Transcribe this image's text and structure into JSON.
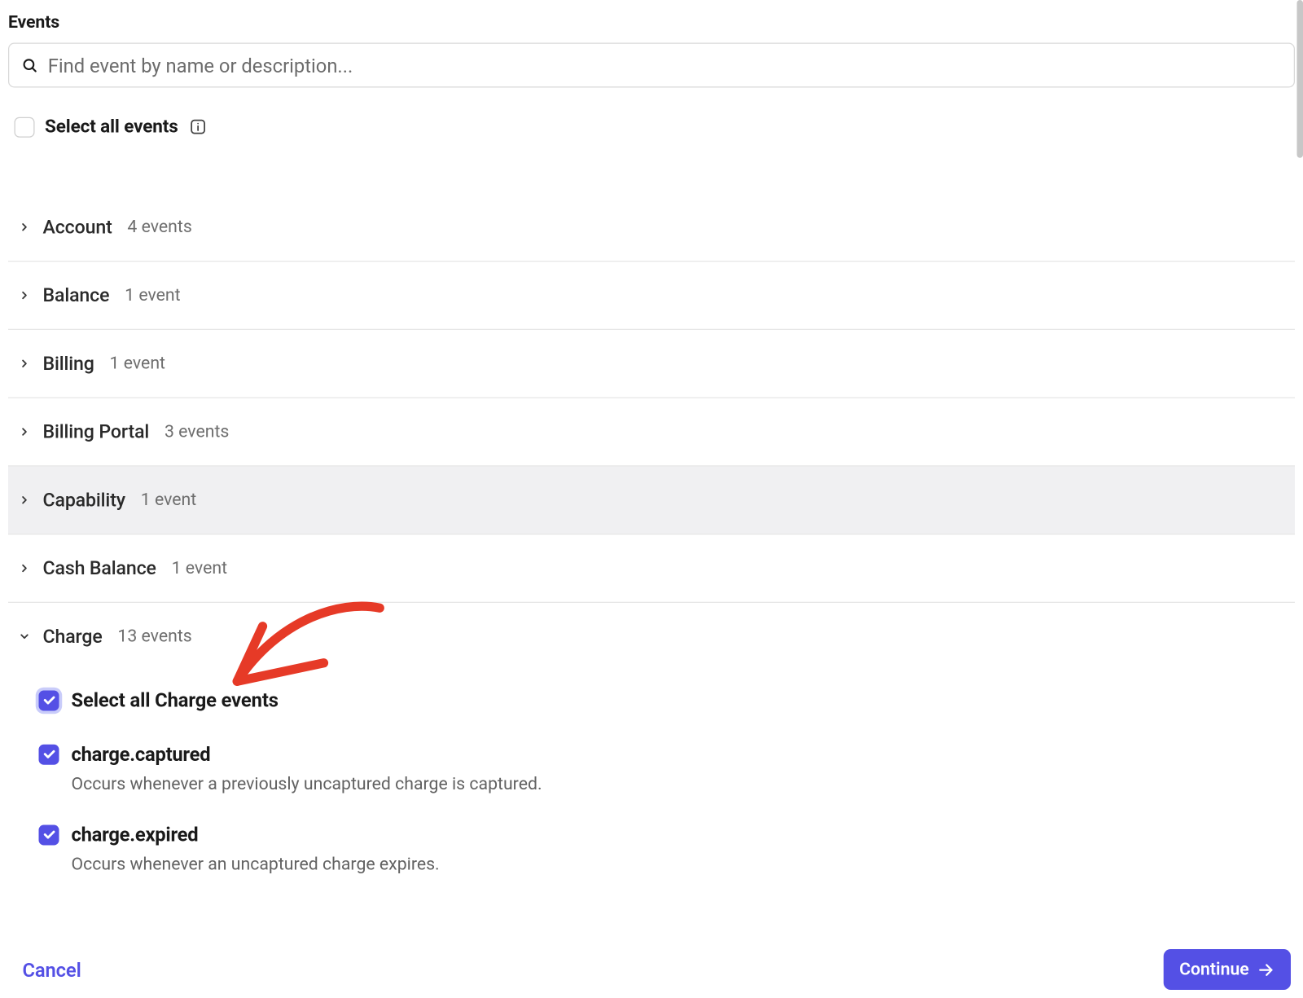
{
  "heading": "Events",
  "search": {
    "placeholder": "Find event by name or description..."
  },
  "select_all": {
    "label": "Select all events",
    "checked": false
  },
  "groups": [
    {
      "name": "Account",
      "count": "4 events",
      "expanded": false,
      "highlight": false
    },
    {
      "name": "Balance",
      "count": "1 event",
      "expanded": false,
      "highlight": false
    },
    {
      "name": "Billing",
      "count": "1 event",
      "expanded": false,
      "highlight": false
    },
    {
      "name": "Billing Portal",
      "count": "3 events",
      "expanded": false,
      "highlight": false
    },
    {
      "name": "Capability",
      "count": "1 event",
      "expanded": false,
      "highlight": true
    },
    {
      "name": "Cash Balance",
      "count": "1 event",
      "expanded": false,
      "highlight": false
    },
    {
      "name": "Charge",
      "count": "13 events",
      "expanded": true,
      "highlight": false,
      "select_all_label": "Select all Charge events",
      "select_all_checked": true,
      "events": [
        {
          "name": "charge.captured",
          "desc": "Occurs whenever a previously uncaptured charge is captured.",
          "checked": true
        },
        {
          "name": "charge.expired",
          "desc": "Occurs whenever an uncaptured charge expires.",
          "checked": true
        }
      ]
    }
  ],
  "footer": {
    "cancel": "Cancel",
    "continue": "Continue"
  }
}
